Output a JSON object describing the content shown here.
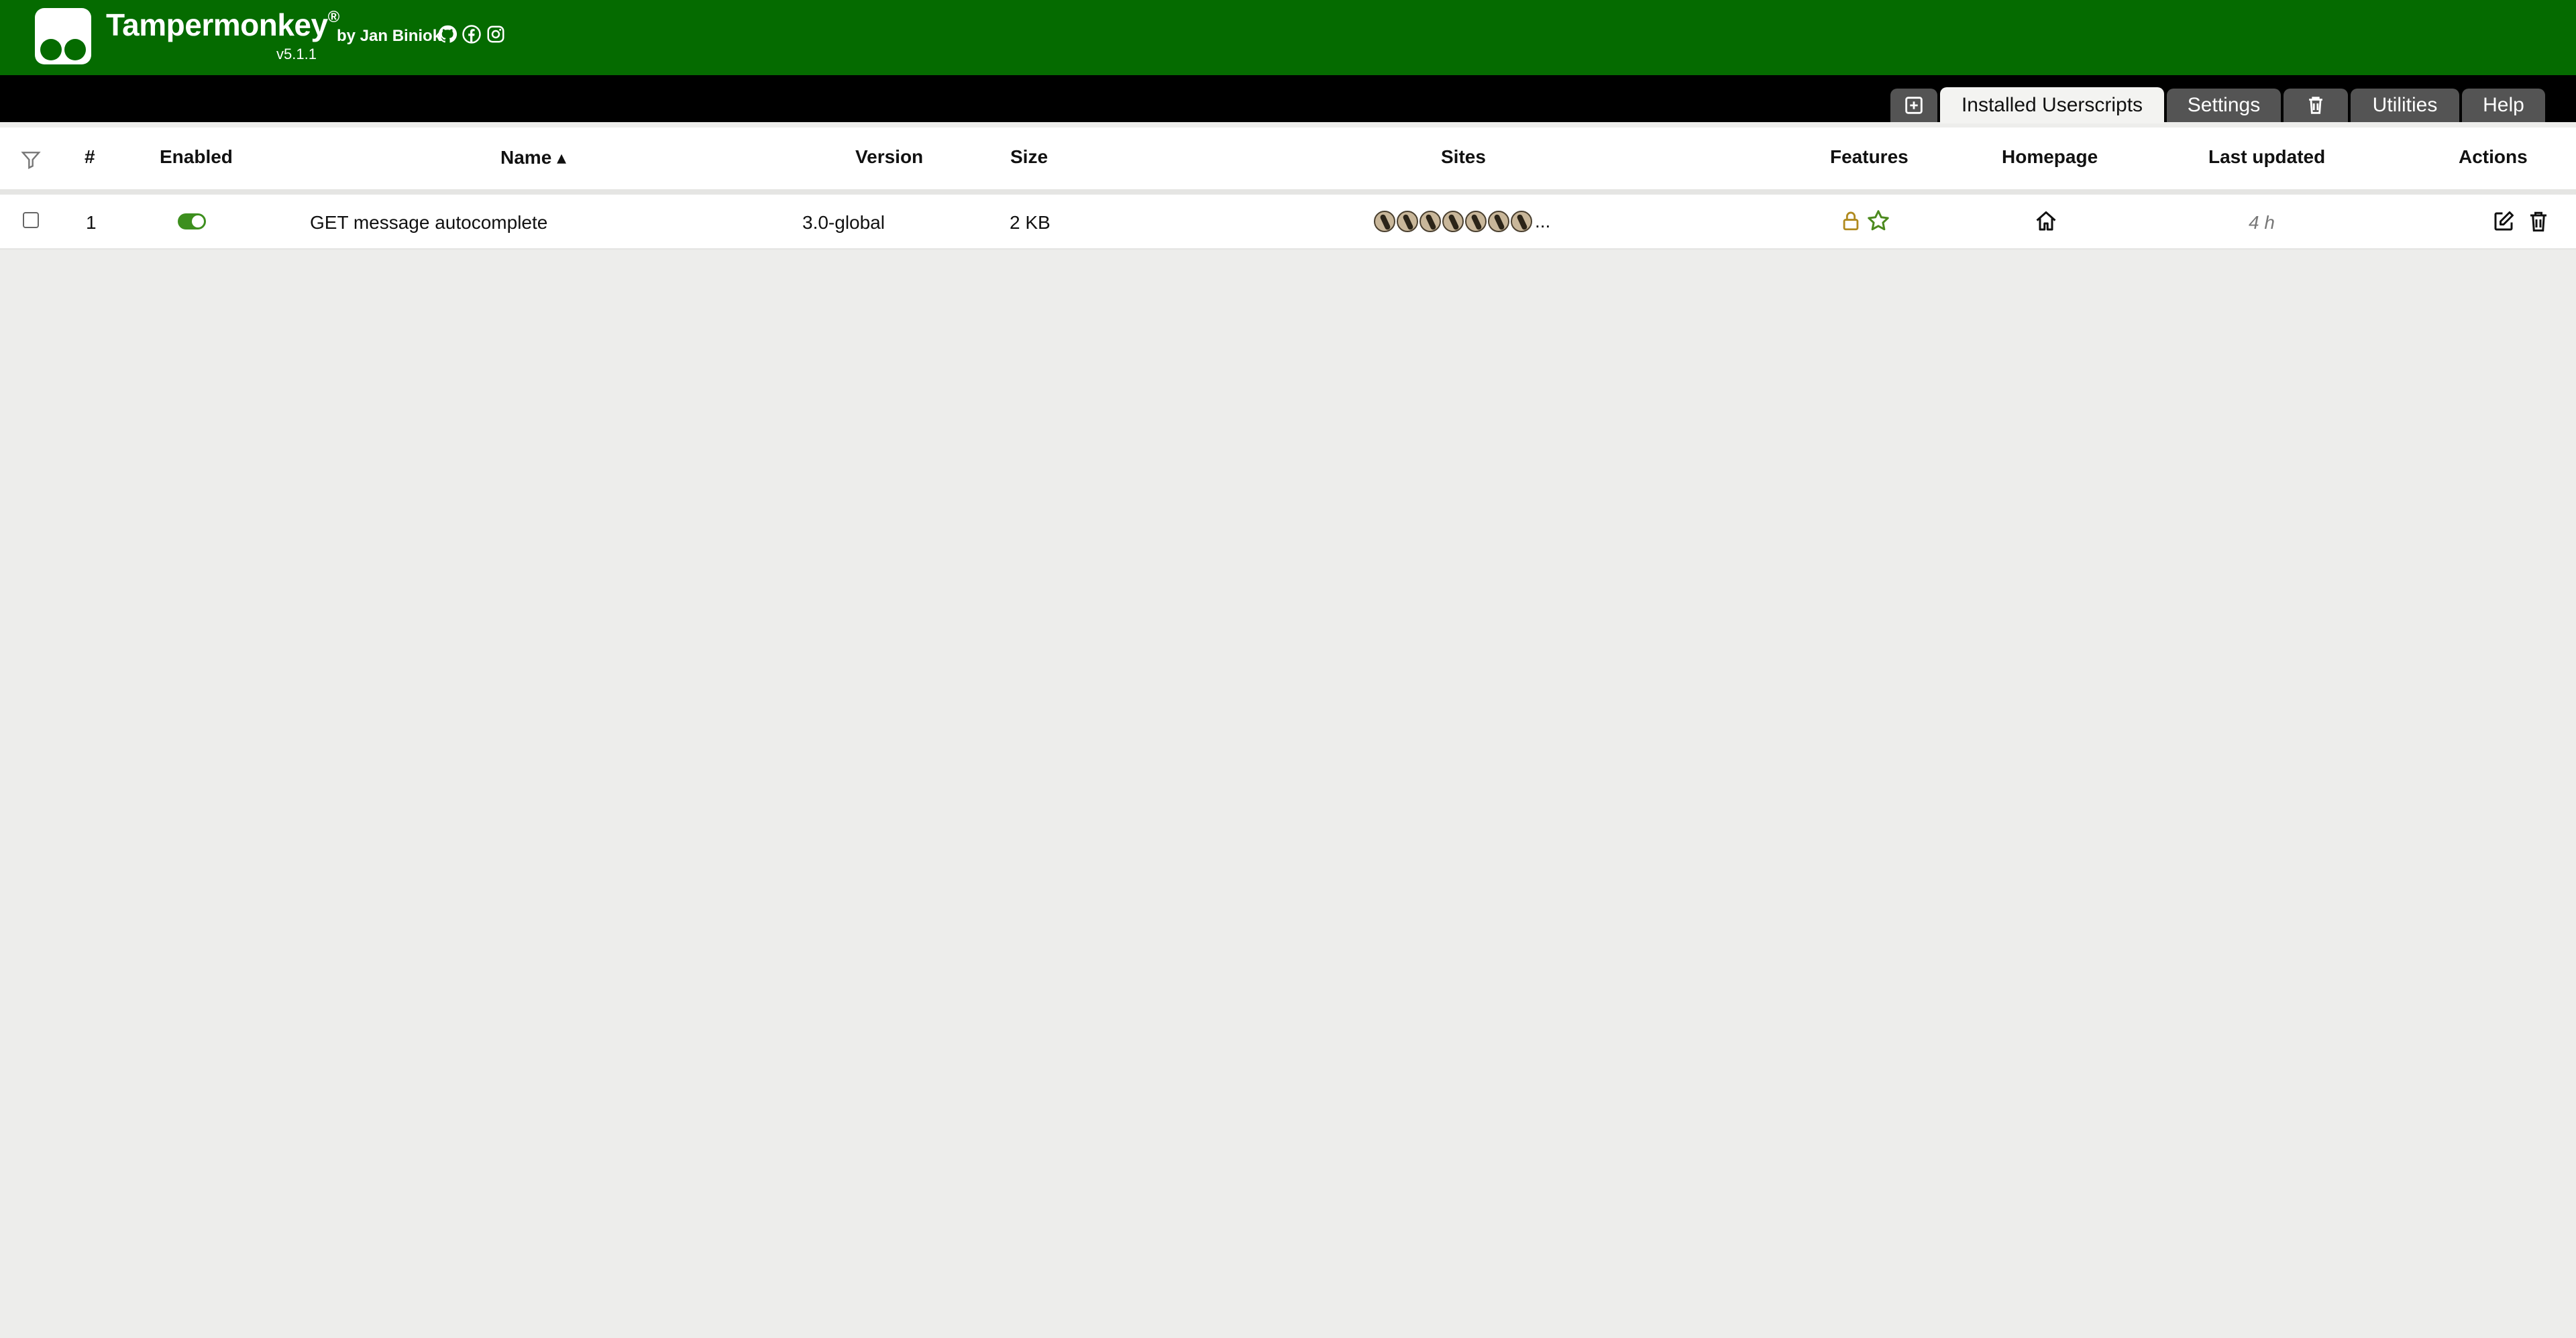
{
  "header": {
    "brand": "Tampermonkey",
    "registered": "®",
    "byline": "by Jan Biniok",
    "version": "v5.1.1",
    "social_icons": [
      "github-icon",
      "facebook-icon",
      "instagram-icon"
    ],
    "background_color": "#056b00"
  },
  "tabs": [
    {
      "icon": "add-script-icon",
      "label": ""
    },
    {
      "label": "Installed Userscripts",
      "active": true
    },
    {
      "label": "Settings"
    },
    {
      "icon": "trash-icon",
      "label": ""
    },
    {
      "label": "Utilities"
    },
    {
      "label": "Help"
    }
  ],
  "table": {
    "columns": {
      "filter": "filter-icon",
      "number": "#",
      "enabled": "Enabled",
      "name": "Name ▴",
      "version": "Version",
      "size": "Size",
      "sites": "Sites",
      "features": "Features",
      "homepage": "Homepage",
      "last_updated": "Last updated",
      "actions": "Actions"
    },
    "rows": [
      {
        "checked": false,
        "number": "1",
        "enabled": true,
        "name": "GET message autocomplete",
        "version": "3.0-global",
        "size": "2 KB",
        "site_icon_count": 7,
        "sites_more": "...",
        "features": [
          "lock-icon",
          "star-icon"
        ],
        "homepage": "home-icon",
        "last_updated": "4 h",
        "actions": [
          "edit-icon",
          "delete-icon"
        ]
      }
    ]
  },
  "colors": {
    "accent_green": "#3d8f1e",
    "feature_lock": "#b08a1e",
    "feature_star": "#4c8a1e"
  }
}
